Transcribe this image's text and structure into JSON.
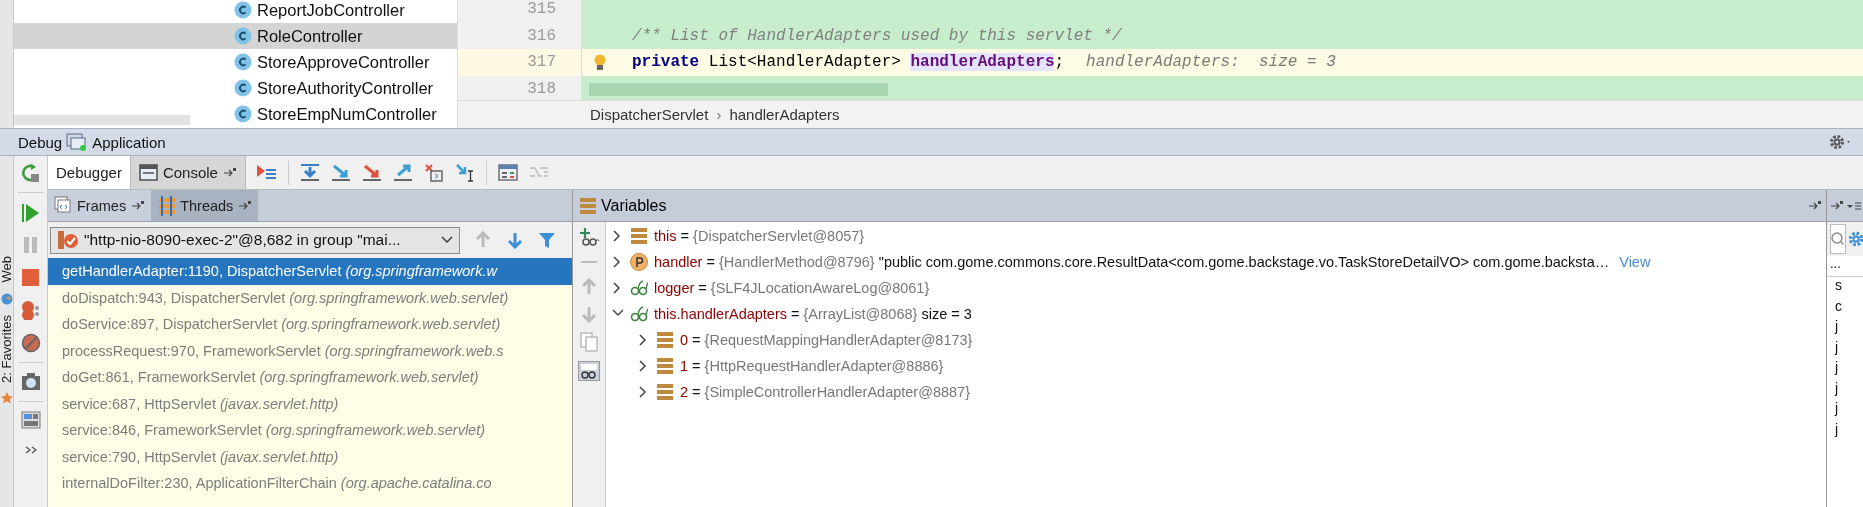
{
  "project_tree": {
    "items": [
      {
        "label": "ReportJobController",
        "selected": false
      },
      {
        "label": "RoleController",
        "selected": true
      },
      {
        "label": "StoreApproveController",
        "selected": false
      },
      {
        "label": "StoreAuthorityController",
        "selected": false
      },
      {
        "label": "StoreEmpNumController",
        "selected": false
      }
    ]
  },
  "editor": {
    "lines": [
      {
        "number": "315",
        "current": false
      },
      {
        "number": "316",
        "current": false,
        "tokens": [
          {
            "kind": "comment",
            "text": "/** List of HandlerAdapters used by this servlet */"
          }
        ]
      },
      {
        "number": "317",
        "current": true,
        "tokens": [
          {
            "kind": "keyword",
            "text": "private"
          },
          {
            "kind": "plain",
            "text": " List<HandlerAdapter> "
          },
          {
            "kind": "field",
            "text": "handlerAdapters"
          },
          {
            "kind": "plain",
            "text": ";"
          },
          {
            "kind": "hint",
            "text": "handlerAdapters:  size = 3"
          }
        ]
      },
      {
        "number": "318",
        "current": false
      }
    ],
    "breadcrumbs": {
      "items": [
        "DispatcherServlet",
        "handlerAdapters"
      ],
      "separator": "›"
    }
  },
  "debug": {
    "title": "Debug",
    "configuration": "Application",
    "tabs": [
      {
        "label": "Debugger",
        "selected": true
      },
      {
        "label": "Console",
        "selected": false
      }
    ]
  },
  "side_strip": [
    "Web",
    "2: Favorites"
  ],
  "frames_panel": {
    "tabs": [
      {
        "label": "Frames",
        "selected": false
      },
      {
        "label": "Threads",
        "selected": true
      }
    ],
    "thread": "\"http-nio-8090-exec-2\"@8,682 in group \"mai...",
    "frames": [
      {
        "location": "getHandlerAdapter:1190, DispatcherServlet",
        "package": "(org.springframework.w",
        "selected": true
      },
      {
        "location": "doDispatch:943, DispatcherServlet",
        "package": "(org.springframework.web.servlet)",
        "selected": false
      },
      {
        "location": "doService:897, DispatcherServlet",
        "package": "(org.springframework.web.servlet)",
        "selected": false
      },
      {
        "location": "processRequest:970, FrameworkServlet",
        "package": "(org.springframework.web.s",
        "selected": false
      },
      {
        "location": "doGet:861, FrameworkServlet",
        "package": "(org.springframework.web.servlet)",
        "selected": false
      },
      {
        "location": "service:687, HttpServlet",
        "package": "(javax.servlet.http)",
        "selected": false
      },
      {
        "location": "service:846, FrameworkServlet",
        "package": "(org.springframework.web.servlet)",
        "selected": false
      },
      {
        "location": "service:790, HttpServlet",
        "package": "(javax.servlet.http)",
        "selected": false
      },
      {
        "location": "internalDoFilter:230, ApplicationFilterChain",
        "package": "(org.apache.catalina.co",
        "selected": false
      }
    ]
  },
  "variables": {
    "title": "Variables",
    "assign": " = ",
    "items": [
      {
        "kind": "object",
        "name": "this",
        "value": "{DispatcherServlet@8057}",
        "expanded": false
      },
      {
        "kind": "parameter",
        "name": "handler",
        "value": "{HandlerMethod@8796}",
        "detail": "\"public com.gome.commons.core.ResultData<com.gome.backstage.vo.TaskStoreDetailVO> com.gome.backsta…",
        "link": "View",
        "expanded": false
      },
      {
        "kind": "field",
        "name": "logger",
        "value": "{SLF4JLocationAwareLog@8061}",
        "expanded": false
      },
      {
        "kind": "field",
        "name": "this.handlerAdapters",
        "value": "{ArrayList@8068}",
        "detail": " size = 3",
        "expanded": true,
        "children": [
          {
            "kind": "object",
            "name": "0",
            "value": "{RequestMappingHandlerAdapter@8173}",
            "expanded": false
          },
          {
            "kind": "object",
            "name": "1",
            "value": "{HttpRequestHandlerAdapter@8886}",
            "expanded": false
          },
          {
            "kind": "object",
            "name": "2",
            "value": "{SimpleControllerHandlerAdapter@8887}",
            "expanded": false
          }
        ]
      }
    ]
  },
  "right_panel": {
    "column": "...",
    "items": [
      "s",
      "c",
      "j",
      "j",
      "j",
      "j",
      "j",
      "j"
    ]
  }
}
